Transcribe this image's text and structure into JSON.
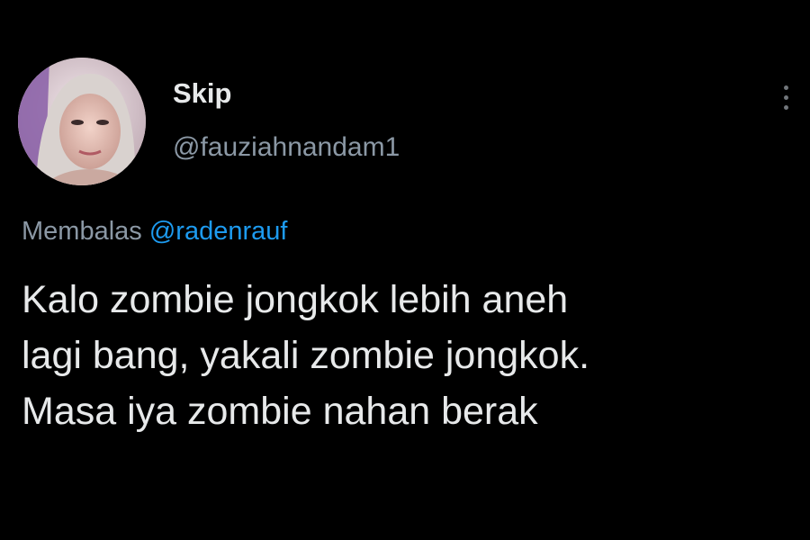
{
  "author": {
    "display_name": "Skip",
    "handle": "@fauziahnandam1",
    "avatar": "profile-photo"
  },
  "reply": {
    "prefix": "Membalas",
    "mention": "@radenrauf"
  },
  "tweet": {
    "lines": [
      "Kalo zombie jongkok lebih aneh",
      "lagi bang, yakali zombie jongkok.",
      "Masa iya zombie nahan berak"
    ]
  },
  "icons": {
    "more": "more-vertical-icon"
  },
  "colors": {
    "background": "#000000",
    "text_primary": "#e7e9ea",
    "text_secondary": "#8b98a5",
    "accent": "#1d9bf0"
  }
}
